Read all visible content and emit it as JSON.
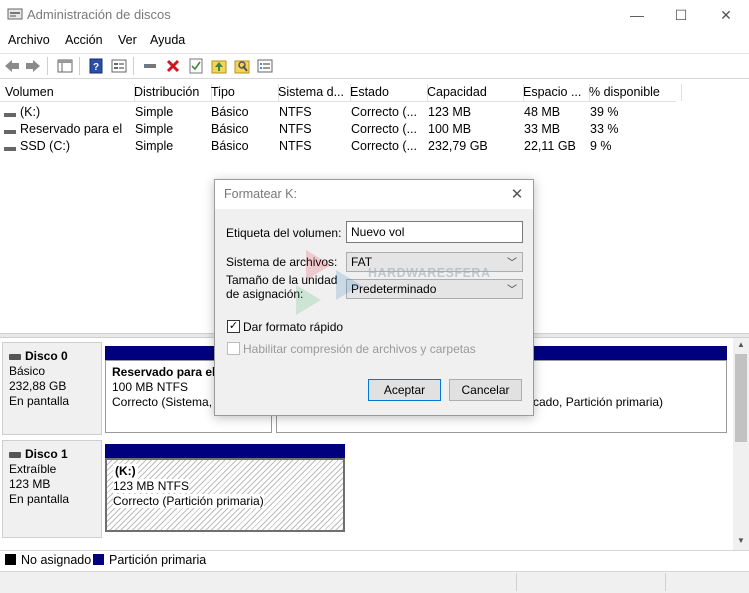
{
  "window": {
    "title": "Administración de discos",
    "controls": {
      "minimize": "—",
      "maximize": "☐",
      "close": "✕"
    }
  },
  "menu": [
    "Archivo",
    "Acción",
    "Ver",
    "Ayuda"
  ],
  "toolbar_icons": [
    "back-icon",
    "forward-icon",
    "list-view-icon",
    "help-icon",
    "properties-icon",
    "connect-icon",
    "delete-icon",
    "check-icon",
    "import-icon",
    "folder-icon",
    "settings-icon"
  ],
  "volume_list": {
    "columns": [
      "Volumen",
      "Distribución",
      "Tipo",
      "Sistema d...",
      "Estado",
      "Capacidad",
      "Espacio ...",
      "% disponible"
    ],
    "rows": [
      [
        "(K:)",
        "Simple",
        "Básico",
        "NTFS",
        "Correcto (...",
        "123 MB",
        "48 MB",
        "39 %"
      ],
      [
        "Reservado para el ...",
        "Simple",
        "Básico",
        "NTFS",
        "Correcto (...",
        "100 MB",
        "33 MB",
        "33 %"
      ],
      [
        "SSD (C:)",
        "Simple",
        "Básico",
        "NTFS",
        "Correcto (...",
        "232,79 GB",
        "22,11 GB",
        "9 %"
      ]
    ]
  },
  "disks": [
    {
      "name": "Disco 0",
      "type": "Básico",
      "size": "232,88 GB",
      "status": "En pantalla",
      "partitions": [
        {
          "title": "Reservado para el",
          "fs": "100 MB NTFS",
          "status": "Correcto (Sistema, A"
        },
        {
          "title": "",
          "fs": "",
          "status": "cado, Partición primaria)"
        }
      ]
    },
    {
      "name": "Disco 1",
      "type": "Extraíble",
      "size": "123 MB",
      "status": "En pantalla",
      "partitions": [
        {
          "title": "(K:)",
          "fs": "123 MB NTFS",
          "status": "Correcto (Partición primaria)"
        }
      ]
    }
  ],
  "legend": [
    {
      "label": "No asignado",
      "color": "#000000"
    },
    {
      "label": "Partición primaria",
      "color": "#00007f"
    }
  ],
  "dialog": {
    "title": "Formatear K:",
    "volume_label_label": "Etiqueta del volumen:",
    "volume_label_value": "Nuevo vol",
    "fs_label": "Sistema de archivos:",
    "fs_value": "FAT",
    "alloc_label_1": "Tamaño de la unidad",
    "alloc_label_2": "de asignación:",
    "alloc_value": "Predeterminado",
    "quick_format_label": "Dar formato rápido",
    "quick_format_checked": true,
    "compression_label": "Habilitar compresión de archivos y carpetas",
    "compression_checked": false,
    "ok_label": "Aceptar",
    "cancel_label": "Cancelar"
  },
  "watermark": "HARDWARESFERA"
}
